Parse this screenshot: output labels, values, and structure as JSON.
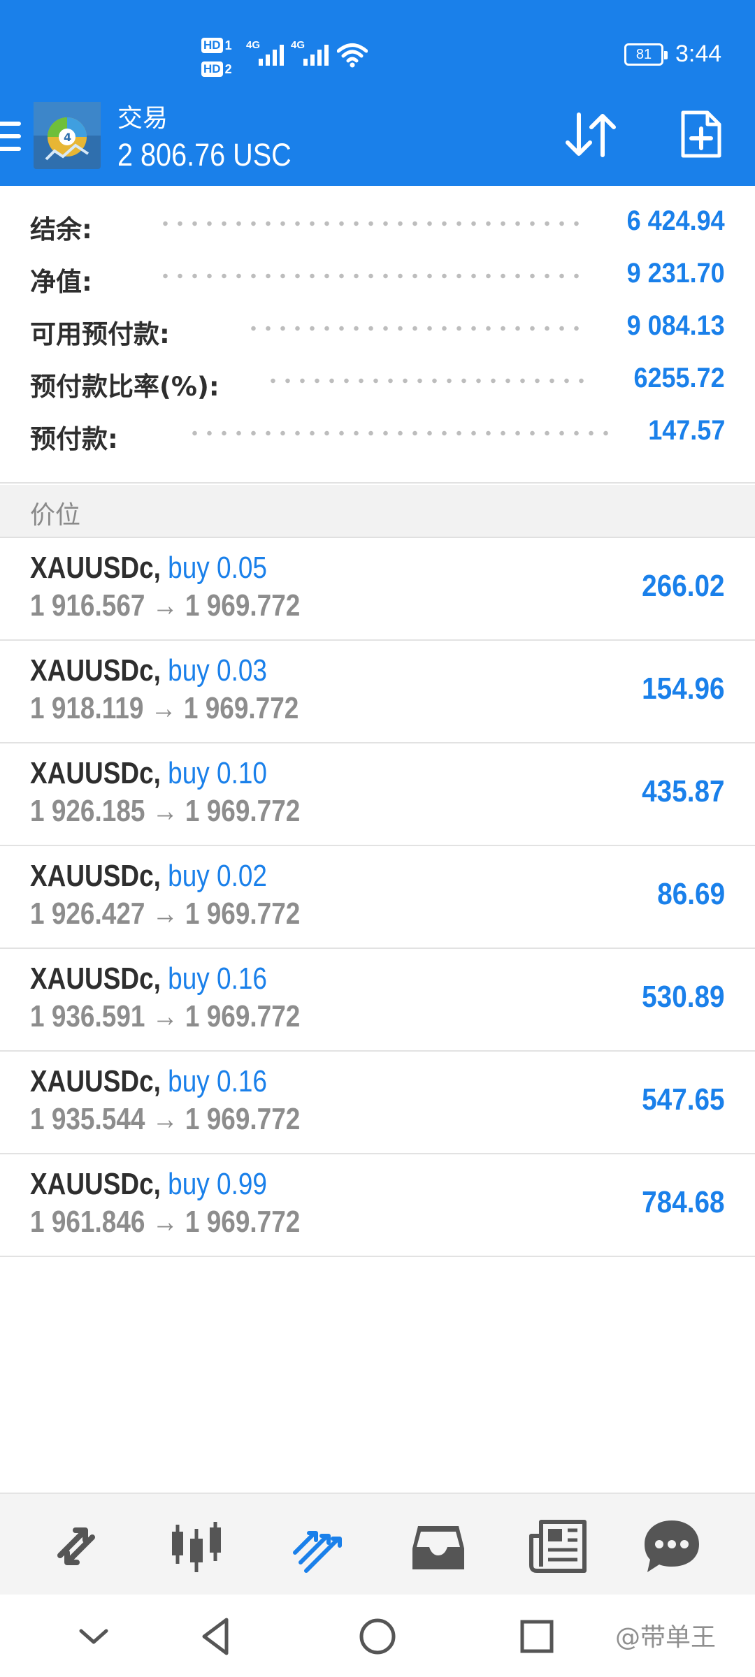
{
  "status_bar": {
    "sim1_tag": "HD",
    "sim1_num": "1",
    "sim2_tag": "HD",
    "sim2_num": "2",
    "network1": "4G",
    "network2": "4G",
    "battery": "81",
    "time": "3:44"
  },
  "header": {
    "title": "交易",
    "balance": "2 806.76 USC"
  },
  "summary": [
    {
      "label": "结余:",
      "value": "6 424.94"
    },
    {
      "label": "净值:",
      "value": "9 231.70"
    },
    {
      "label": "可用预付款:",
      "value": "9 084.13"
    },
    {
      "label": "预付款比率(%):",
      "value": "6255.72"
    },
    {
      "label": "预付款:",
      "value": "147.57"
    }
  ],
  "positions_header": "价位",
  "positions": [
    {
      "symbol": "XAUUSDc,",
      "type": "buy 0.05",
      "prices": "1 916.567 → 1 969.772",
      "profit": "266.02"
    },
    {
      "symbol": "XAUUSDc,",
      "type": "buy 0.03",
      "prices": "1 918.119 → 1 969.772",
      "profit": "154.96"
    },
    {
      "symbol": "XAUUSDc,",
      "type": "buy 0.10",
      "prices": "1 926.185 → 1 969.772",
      "profit": "435.87"
    },
    {
      "symbol": "XAUUSDc,",
      "type": "buy 0.02",
      "prices": "1 926.427 → 1 969.772",
      "profit": "86.69"
    },
    {
      "symbol": "XAUUSDc,",
      "type": "buy 0.16",
      "prices": "1 936.591 → 1 969.772",
      "profit": "530.89"
    },
    {
      "symbol": "XAUUSDc,",
      "type": "buy 0.16",
      "prices": "1 935.544 → 1 969.772",
      "profit": "547.65"
    },
    {
      "symbol": "XAUUSDc,",
      "type": "buy 0.99",
      "prices": "1 961.846 → 1 969.772",
      "profit": "784.68"
    }
  ],
  "tabs": [
    {
      "name": "quotes",
      "icon": "arrows-diagonal-icon"
    },
    {
      "name": "chart",
      "icon": "candlestick-icon"
    },
    {
      "name": "trade",
      "icon": "trend-lines-icon",
      "active": true
    },
    {
      "name": "history",
      "icon": "inbox-icon"
    },
    {
      "name": "news",
      "icon": "newspaper-icon"
    },
    {
      "name": "chat",
      "icon": "chat-bubble-icon"
    }
  ],
  "watermark": "@带单王",
  "colors": {
    "accent": "#1a80ea",
    "label_text": "#2e2e2e",
    "secondary_text": "#8d8d8d",
    "tabbar_bg": "#f4f4f4",
    "icon_gray": "#555555"
  }
}
